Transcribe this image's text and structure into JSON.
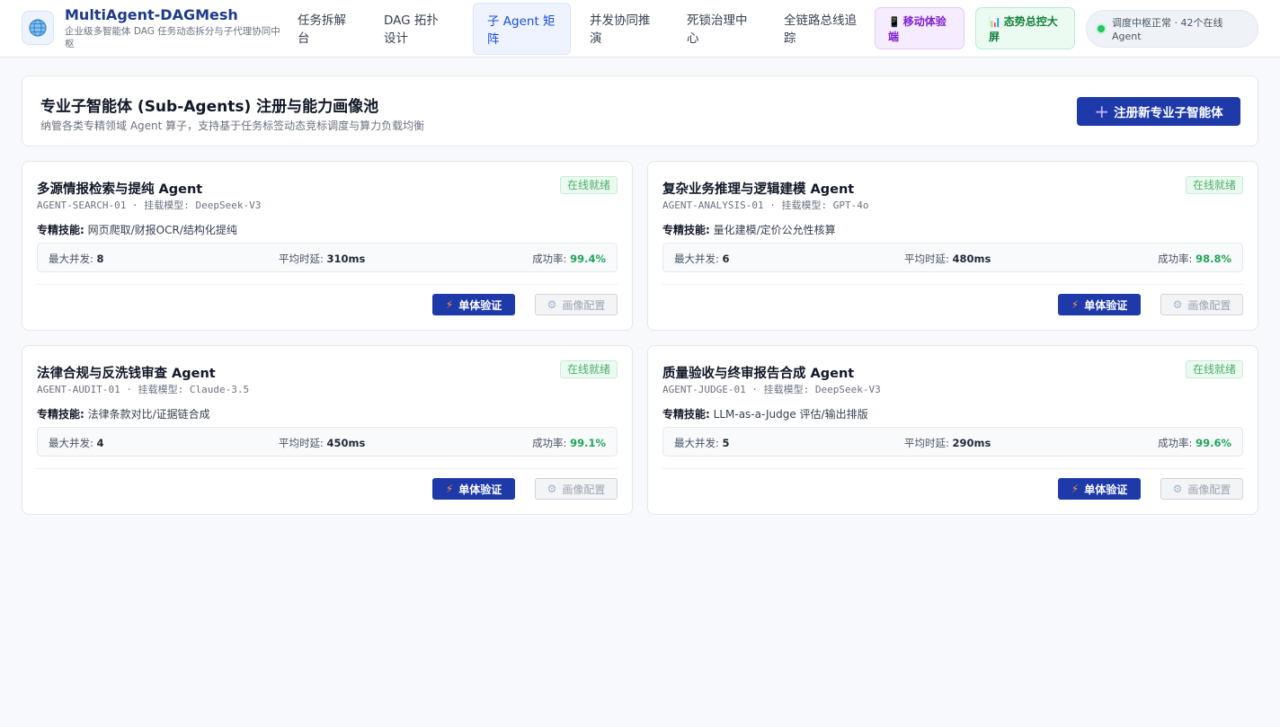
{
  "header": {
    "brand_title": "MultiAgent-DAGMesh",
    "brand_subtitle": "企业级多智能体 DAG 任务动态拆分与子代理协同中枢",
    "nav": [
      {
        "label": "任务拆解台"
      },
      {
        "label": "DAG 拓扑设计"
      },
      {
        "label": "子 Agent 矩阵"
      },
      {
        "label": "并发协同推演"
      },
      {
        "label": "死锁治理中心"
      },
      {
        "label": "全链路总线追踪"
      }
    ],
    "mobile_button": "移动体验端",
    "screen_button": "态势总控大屏",
    "status_text": "调度中枢正常 · 42个在线Agent"
  },
  "hero": {
    "title": "专业子智能体 (Sub-Agents) 注册与能力画像池",
    "subtitle": "纳管各类专精领域 Agent 算子，支持基于任务标签动态竞标调度与算力负载均衡",
    "register_button": "注册新专业子智能体"
  },
  "labels": {
    "skills": "专精技能:",
    "max_concurrency": "最大并发:",
    "avg_latency": "平均时延:",
    "success_rate": "成功率:",
    "verify_button": "单体验证",
    "config_button": "画像配置",
    "model_prefix": "挂载模型:"
  },
  "agents": [
    {
      "name": "多源情报检索与提纯 Agent",
      "id": "AGENT-SEARCH-01",
      "model": "DeepSeek-V3",
      "status": "在线就绪",
      "skills": "网页爬取/财报OCR/结构化提纯",
      "max_concurrency": "8",
      "avg_latency": "310ms",
      "success_rate": "99.4%"
    },
    {
      "name": "复杂业务推理与逻辑建模 Agent",
      "id": "AGENT-ANALYSIS-01",
      "model": "GPT-4o",
      "status": "在线就绪",
      "skills": "量化建模/定价公允性核算",
      "max_concurrency": "6",
      "avg_latency": "480ms",
      "success_rate": "98.8%"
    },
    {
      "name": "法律合规与反洗钱审查 Agent",
      "id": "AGENT-AUDIT-01",
      "model": "Claude-3.5",
      "status": "在线就绪",
      "skills": "法律条款对比/证据链合成",
      "max_concurrency": "4",
      "avg_latency": "450ms",
      "success_rate": "99.1%"
    },
    {
      "name": "质量验收与终审报告合成 Agent",
      "id": "AGENT-JUDGE-01",
      "model": "DeepSeek-V3",
      "status": "在线就绪",
      "skills": "LLM-as-a-Judge 评估/输出排版",
      "max_concurrency": "5",
      "avg_latency": "290ms",
      "success_rate": "99.6%"
    }
  ],
  "colors": {
    "primary": "#1e3aa8",
    "online_green": "#4ead6c",
    "success_green": "#22a55a",
    "mobile_purple": "#7e22ce",
    "screen_green": "#15803d"
  }
}
